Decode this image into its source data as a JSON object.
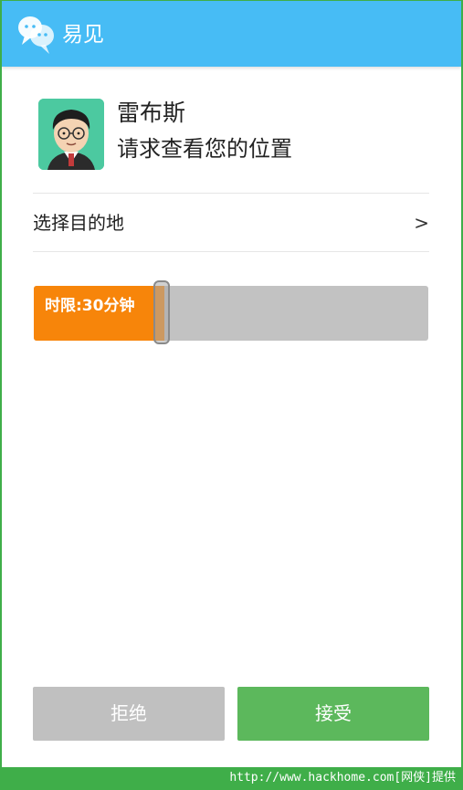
{
  "app": {
    "title": "易见",
    "logo_icon": "chat-bubbles-icon",
    "header_color": "#47bcf5"
  },
  "request": {
    "avatar_icon": "avatar-cartoon-man-icon",
    "name": "雷布斯",
    "message": "请求查看您的位置"
  },
  "destination": {
    "label": "选择目的地",
    "chevron": ">"
  },
  "time_limit": {
    "label": "时限:30分钟",
    "fill_fraction": 0.33,
    "fill_color": "#f7850a",
    "track_color": "#c2c2c2"
  },
  "actions": {
    "reject_label": "拒绝",
    "accept_label": "接受",
    "accept_color": "#5cb85c",
    "reject_color": "#c0c0c0"
  },
  "watermark": {
    "text": "http://www.hackhome.com[网侠]提供"
  }
}
